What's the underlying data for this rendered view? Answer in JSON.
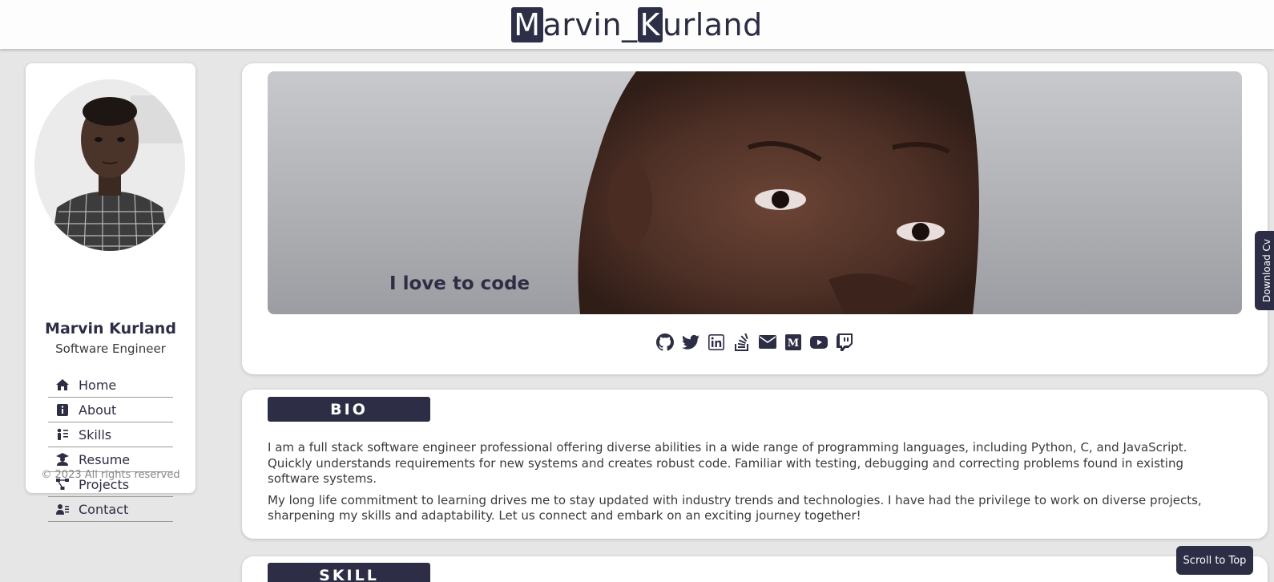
{
  "header": {
    "brand_first_initial": "M",
    "brand_first_rest": "arvin_",
    "brand_last_initial": "K",
    "brand_last_rest": "urland"
  },
  "sidebar": {
    "name": "Marvin Kurland",
    "role": "Software Engineer",
    "items": [
      {
        "label": "Home",
        "icon": "home-icon"
      },
      {
        "label": "About",
        "icon": "info-icon"
      },
      {
        "label": "Skills",
        "icon": "skills-icon"
      },
      {
        "label": "Resume",
        "icon": "graduate-icon"
      },
      {
        "label": "Projects",
        "icon": "projects-icon"
      },
      {
        "label": "Contact",
        "icon": "contact-icon"
      }
    ],
    "copyright": "© 2023 All rights reserved"
  },
  "hero": {
    "tagline": "I love to code",
    "socials": [
      "github-icon",
      "twitter-icon",
      "linkedin-icon",
      "stackoverflow-icon",
      "email-icon",
      "medium-icon",
      "youtube-icon",
      "twitch-icon"
    ]
  },
  "bio": {
    "title": "BIO",
    "paragraphs": [
      "I am a full stack software engineer professional offering diverse abilities in a wide range of programming languages, including Python, C, and JavaScript. Quickly understands requirements for new systems and creates robust code. Familiar with testing, debugging and correcting problems found in existing software systems.",
      "My long life commitment to learning drives me to stay updated with industry trends and technologies. I have had the privilege to work on diverse projects, sharpening my skills and adaptability. Let us connect and embark on an exciting journey together!"
    ]
  },
  "skill": {
    "title": "SKILL"
  },
  "download_cv": "Download Cv",
  "scroll_to_top": "Scroll to Top",
  "colors": {
    "accent": "#2d2e45",
    "background": "#e6e6e6"
  }
}
